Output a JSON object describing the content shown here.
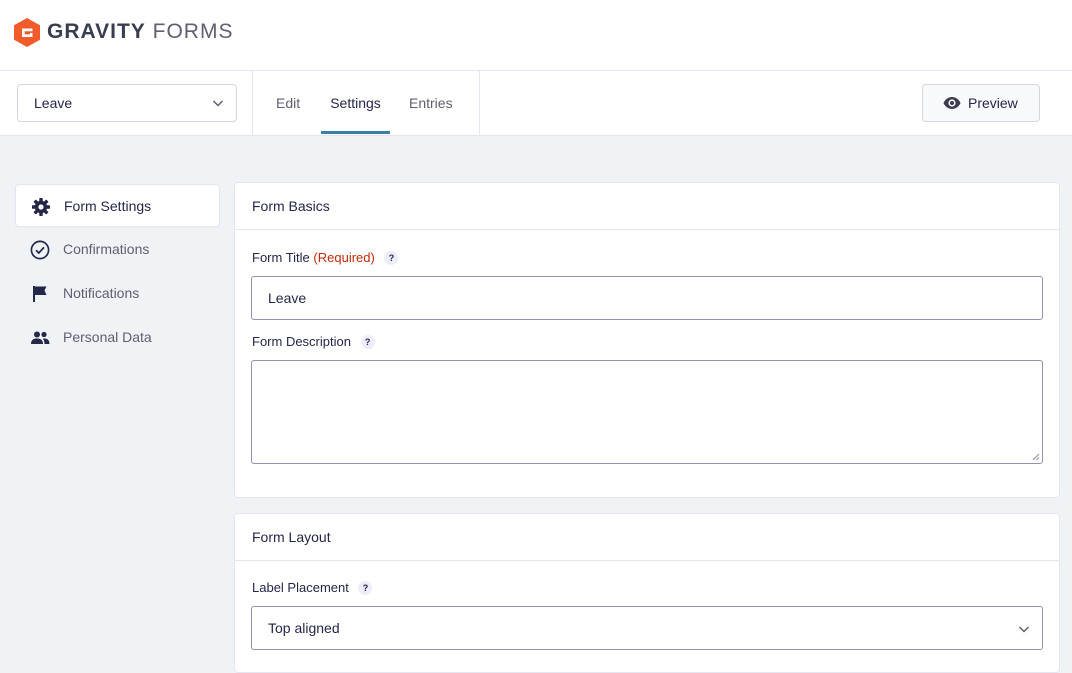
{
  "brand": {
    "name_bold": "GRAVITY",
    "name_light": "FORMS",
    "accent_color": "#f15a2b"
  },
  "toolbar": {
    "form_selector_value": "Leave",
    "tabs": [
      {
        "label": "Edit",
        "active": false
      },
      {
        "label": "Settings",
        "active": true
      },
      {
        "label": "Entries",
        "active": false
      }
    ],
    "preview_label": "Preview",
    "active_tab_color": "#3e7da6"
  },
  "sidebar": {
    "items": [
      {
        "label": "Form Settings",
        "icon": "gear-icon",
        "active": true
      },
      {
        "label": "Confirmations",
        "icon": "check-circle-icon",
        "active": false
      },
      {
        "label": "Notifications",
        "icon": "flag-icon",
        "active": false
      },
      {
        "label": "Personal Data",
        "icon": "people-icon",
        "active": false
      }
    ]
  },
  "form_basics": {
    "title": "Form Basics",
    "form_title_label": "Form Title",
    "required_text": "(Required)",
    "form_title_value": "Leave",
    "form_description_label": "Form Description",
    "form_description_value": "",
    "help_glyph": "?"
  },
  "form_layout": {
    "title": "Form Layout",
    "label_placement_label": "Label Placement",
    "label_placement_value": "Top aligned",
    "help_glyph": "?"
  }
}
